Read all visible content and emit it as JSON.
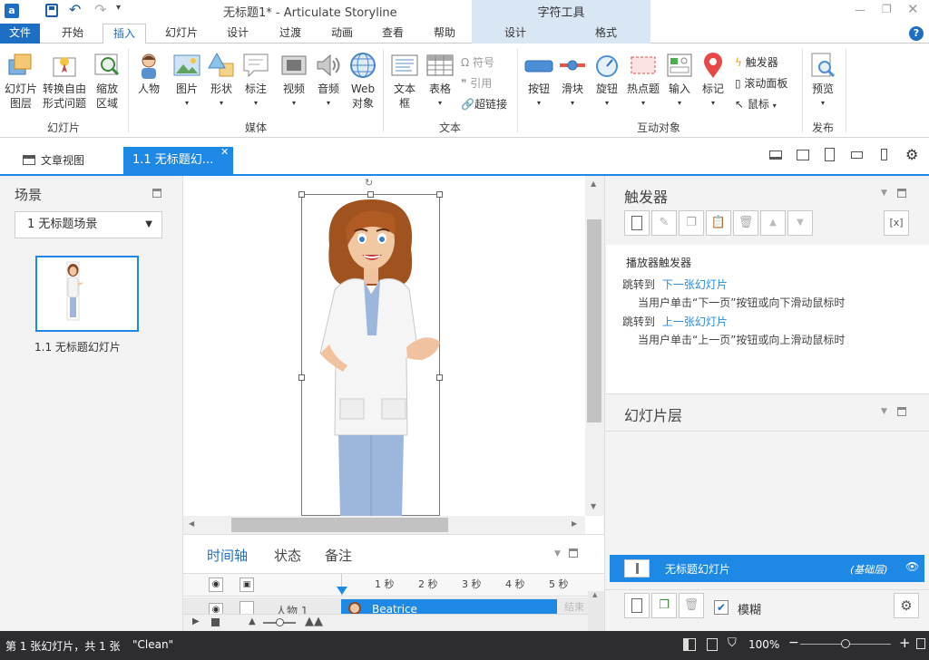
{
  "window": {
    "title": "无标题1* -  Articulate Storyline",
    "context_tool_group": "字符工具"
  },
  "menu": {
    "file": "文件",
    "tabs": [
      "开始",
      "插入",
      "幻灯片",
      "设计",
      "过渡",
      "动画",
      "查看",
      "帮助"
    ],
    "active_tab": "插入",
    "context_tabs": [
      "设计",
      "格式"
    ]
  },
  "ribbon": {
    "groups": {
      "slides": {
        "label": "幻灯片",
        "items": [
          [
            "幻灯片",
            "图层"
          ],
          [
            "转换自由",
            "形式问题"
          ],
          [
            "缩放",
            "区域"
          ]
        ]
      },
      "media": {
        "label": "媒体",
        "items": [
          "人物",
          "图片",
          "形状",
          "标注",
          "视频",
          "音频",
          [
            "Web",
            "对象"
          ]
        ]
      },
      "text": {
        "label": "文本",
        "items": [
          [
            "文本",
            "框"
          ],
          "表格"
        ],
        "small": [
          "符号",
          "引用",
          "超链接"
        ]
      },
      "interactive": {
        "label": "互动对象",
        "items": [
          "按钮",
          "滑块",
          "旋钮",
          "热点题",
          "输入",
          "标记"
        ],
        "small": [
          "触发器",
          "滚动面板",
          "鼠标"
        ]
      },
      "publish": {
        "label": "发布",
        "items": [
          "预览"
        ]
      }
    }
  },
  "viewbar": {
    "story_view": "文章视图",
    "slide_tab": "1.1 无标题幻..."
  },
  "scenes": {
    "title": "场景",
    "dropdown": "1 无标题场景",
    "slide_label": "1.1 无标题幻灯片"
  },
  "timeline": {
    "tabs": [
      "时间轴",
      "状态",
      "备注"
    ],
    "active_tab": "时间轴",
    "ticks": [
      "1 秒",
      "2 秒",
      "3 秒",
      "4 秒",
      "5 秒"
    ],
    "row_name": "人物 1",
    "row_bar_label": "Beatrice",
    "end_label": "结束"
  },
  "triggers": {
    "title": "触发器",
    "section": "播放器触发器",
    "items": [
      {
        "action": "跳转到",
        "target": "下一张幻灯片",
        "condition": "当用户单击“下一页”按钮或向下滑动鼠标时"
      },
      {
        "action": "跳转到",
        "target": "上一张幻灯片",
        "condition": "当用户单击“上一页”按钮或向上滑动鼠标时"
      }
    ]
  },
  "layers": {
    "title": "幻灯片层",
    "base_name": "无标题幻灯片",
    "base_tag": "(基础层)",
    "dim_label": "模糊"
  },
  "status": {
    "left": "第 1 张幻灯片，共 1 张",
    "theme": "\"Clean\"",
    "zoom": "100%"
  },
  "colors": {
    "accent": "#1e88e5",
    "file_tab": "#1e6fc4",
    "status_bg": "#2d2d30",
    "link": "#2b8ad8"
  }
}
